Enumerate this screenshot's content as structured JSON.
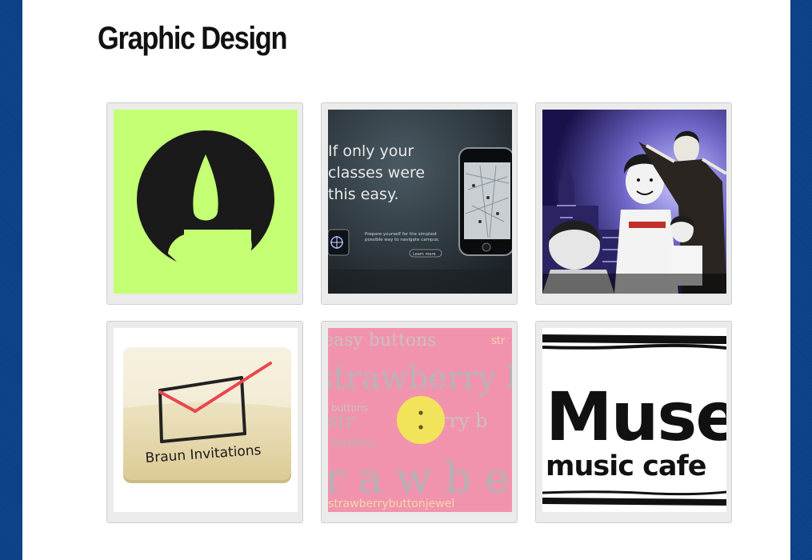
{
  "page": {
    "title": "Graphic Design"
  },
  "gallery": {
    "items": [
      {
        "name": "candle-logo"
      },
      {
        "name": "campus-map-app-ad",
        "headline": [
          "If only your",
          "classes were",
          "this easy."
        ],
        "tagline": [
          "Prepare yourself for the simplest",
          "possible way to navigate campus."
        ],
        "button": "Learn more"
      },
      {
        "name": "illustrated-students-poster"
      },
      {
        "name": "braun-invitations-logo",
        "label": "Braun Invitations"
      },
      {
        "name": "strawberry-buttons-logo",
        "words": [
          "easy buttons",
          "str",
          "strawberry b",
          "buttons",
          "str",
          "rry b",
          "buttons",
          "r a w b e",
          "strawberrybuttonjewel"
        ]
      },
      {
        "name": "muse-music-cafe-logo",
        "label_top": "Muse",
        "label_bottom": "music cafe"
      }
    ]
  }
}
